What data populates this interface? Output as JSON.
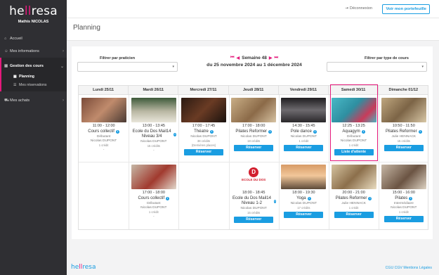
{
  "app": {
    "logo_main": "he",
    "logo_accent": "ll",
    "logo_rest": "resa",
    "user_name": "Mathis NICOLAS"
  },
  "sidebar": {
    "items": [
      {
        "icon": "home-icon",
        "label": "Accueil"
      },
      {
        "icon": "user-icon",
        "label": "Mes informations"
      },
      {
        "icon": "calendar-icon",
        "label": "Gestion des cours"
      },
      {
        "icon": "cart-icon",
        "label": "Mes achats"
      }
    ],
    "sub_items": [
      {
        "icon": "calendar-icon",
        "label": "Planning"
      },
      {
        "icon": "list-icon",
        "label": "Mes réservations"
      }
    ]
  },
  "topbar": {
    "logout_label": "Déconnexion",
    "wallet_label": "Voir mon portefeuille"
  },
  "page": {
    "title": "Planning"
  },
  "filters": {
    "left_label": "Filtrer par praticien",
    "right_label": "Filtrer par type de cours"
  },
  "week": {
    "label": "Semaine 48",
    "range": "du 25 novembre 2024 au 1 décembre 2024"
  },
  "days": [
    "Lundi 25/11",
    "Mardi 26/11",
    "Mercredi 27/11",
    "Jeudi 28/11",
    "Vendredi 29/11",
    "Samedi 30/11",
    "Dimanche 01/12"
  ],
  "row1": [
    {
      "time": "11:00 - 12:00",
      "title": "Cours collectif",
      "level": "Débutant",
      "coach": "Nicolas DUPONT",
      "credits": "1 crédit",
      "action": "",
      "dash": "-"
    },
    {
      "time": "13:00 - 13:45",
      "title": "Ecole du Dos Mail14 Niveau 3/4",
      "level": "",
      "coach": "Nicolas DUPONT",
      "credits": "15 crédits",
      "action": "",
      "dash": "-"
    },
    {
      "time": "17:00 - 17:45",
      "title": "Théatre",
      "level": "",
      "coach": "Nicolas DUPONT",
      "credits": "38 crédits",
      "extra": "(Dernières places)",
      "action": "Réserver"
    },
    {
      "time": "17:00 - 18:00",
      "title": "Pilates Reformer",
      "level": "",
      "coach": "Nicolas DUPONT",
      "credits": "18 crédits",
      "action": "Réserver"
    },
    {
      "time": "14:30 - 15:45",
      "title": "Pole dance",
      "level": "",
      "coach": "Nicolas DUPONT",
      "credits": "1 crédit",
      "action": "Réserver"
    },
    {
      "time": "12:25 - 13:25",
      "title": "Aquagym",
      "level": "Débutant",
      "coach": "Nicolas DUPONT",
      "credits": "1 crédit",
      "action": "Liste d'attente"
    },
    {
      "time": "10:50 - 11:50",
      "title": "Pilates Reformer",
      "level": "",
      "coach": "Julie HENNACK",
      "credits": "15 crédits",
      "action": "Réserver"
    }
  ],
  "row2": [
    {
      "col": 1,
      "time": "17:00 - 18:00",
      "title": "Cours collectif",
      "level": "Débutant",
      "coach": "Nicolas DUPONT",
      "credits": "1 crédit",
      "action": "",
      "dash": "-"
    },
    {
      "col": 3,
      "time": "18:00 - 18:45",
      "title": "Ecole du Dos Mail14 Niveau 1-2",
      "level": "",
      "coach": "Nicolas DUPONT",
      "credits": "15 crédits",
      "action": "Réserver",
      "logo_text": "ECOLE DU DOS"
    },
    {
      "col": 4,
      "time": "18:00 - 19:30",
      "title": "Yoga",
      "level": "",
      "coach": "Nicolas DUPONT",
      "credits": "17 crédits",
      "action": "Réserver"
    },
    {
      "col": 5,
      "time": "20:00 - 21:00",
      "title": "Pilates Reformer",
      "level": "",
      "coach": "Julie HENNACK",
      "credits": "1 crédit",
      "action": "Réserver"
    },
    {
      "col": 6,
      "time": "15:00 - 16:00",
      "title": "Pilates",
      "level": "Intermédiaire",
      "coach": "Nicolas DUPONT",
      "credits": "1 crédit",
      "action": "Réserver"
    }
  ],
  "footer": {
    "logo_main": "he",
    "logo_accent": "ll",
    "logo_rest": "resa",
    "links": "CGU CGV Mentions Légales"
  }
}
